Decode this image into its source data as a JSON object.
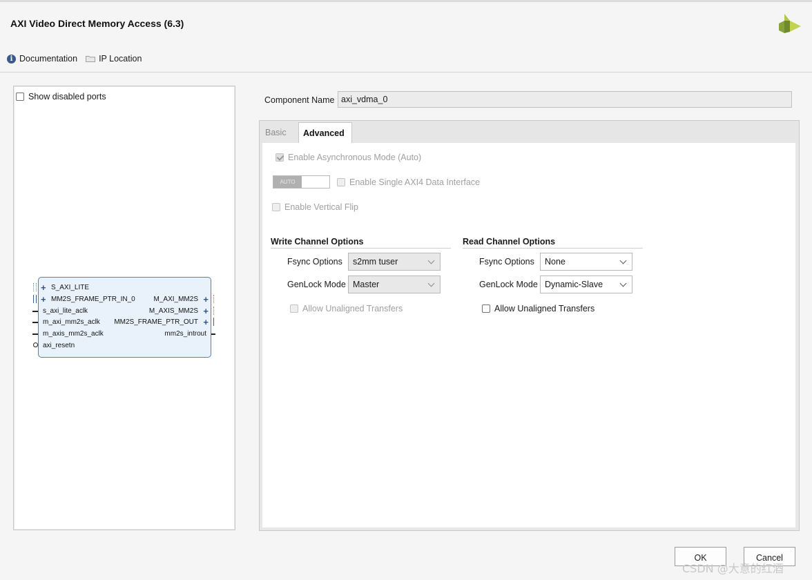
{
  "window": {
    "title": "AXI Video Direct Memory Access (6.3)"
  },
  "links": {
    "documentation": "Documentation",
    "ip_location": "IP Location"
  },
  "left_panel": {
    "show_disabled_ports": "Show disabled ports",
    "block": {
      "left_ports": [
        "S_AXI_LITE",
        "MM2S_FRAME_PTR_IN_0",
        "s_axi_lite_aclk",
        "m_axi_mm2s_aclk",
        "m_axis_mm2s_aclk",
        "axi_resetn"
      ],
      "right_ports": [
        "M_AXI_MM2S",
        "M_AXIS_MM2S",
        "MM2S_FRAME_PTR_OUT",
        "mm2s_introut"
      ]
    }
  },
  "component": {
    "label": "Component Name",
    "value": "axi_vdma_0"
  },
  "tabs": {
    "basic": "Basic",
    "advanced": "Advanced"
  },
  "advanced": {
    "enable_async": "Enable Asynchronous Mode (Auto)",
    "toggle_text": "AUTO",
    "single_axi4": "Enable Single AXI4 Data Interface",
    "vertical_flip": "Enable Vertical Flip",
    "write": {
      "title": "Write Channel Options",
      "fsync_label": "Fsync Options",
      "fsync_value": "s2mm tuser",
      "genlock_label": "GenLock Mode",
      "genlock_value": "Master",
      "unaligned": "Allow Unaligned Transfers"
    },
    "read": {
      "title": "Read Channel Options",
      "fsync_label": "Fsync Options",
      "fsync_value": "None",
      "genlock_label": "GenLock Mode",
      "genlock_value": "Dynamic-Slave",
      "unaligned": "Allow Unaligned Transfers"
    }
  },
  "buttons": {
    "ok": "OK",
    "cancel": "Cancel"
  },
  "watermark": "CSDN @大意的红酒"
}
